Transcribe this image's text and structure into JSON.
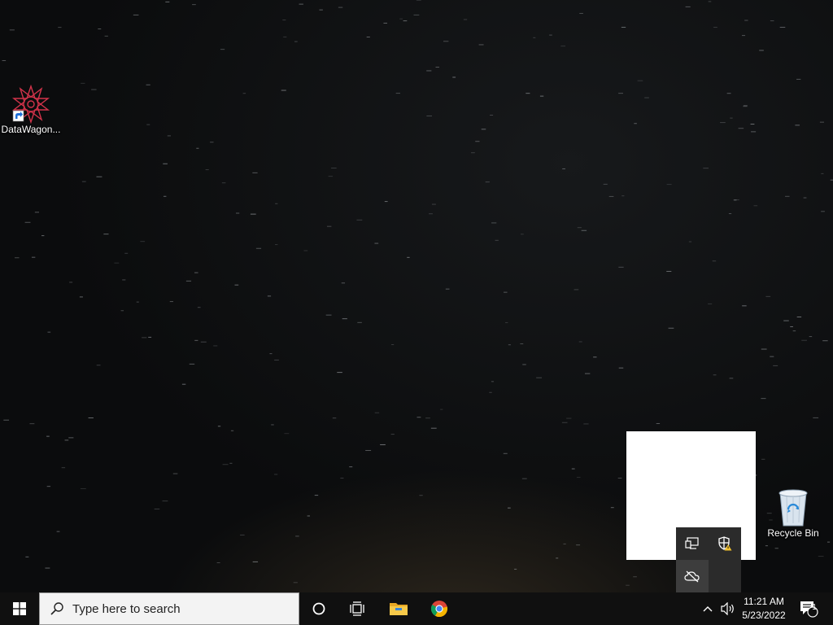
{
  "desktop": {
    "icons": [
      {
        "label": "DataWagon...",
        "icon": "datawagon-app-icon"
      },
      {
        "label": "Recycle Bin",
        "icon": "recycle-bin-icon"
      }
    ]
  },
  "taskbar": {
    "start_icon": "windows-logo-icon",
    "search": {
      "placeholder": "Type here to search",
      "icon": "search-icon"
    },
    "pinned": [
      {
        "name": "cortana",
        "icon": "cortana-icon"
      },
      {
        "name": "task-view",
        "icon": "task-view-icon"
      },
      {
        "name": "file-explorer",
        "icon": "file-explorer-icon"
      },
      {
        "name": "chrome",
        "icon": "chrome-icon"
      }
    ],
    "tray": {
      "chevron_icon": "chevron-up-icon",
      "volume_icon": "volume-icon",
      "time": "11:21 AM",
      "date": "5/23/2022",
      "notifications_count": "1"
    }
  },
  "tray_overflow": {
    "icons": [
      "network-icon",
      "security-warning-icon",
      "cloud-offline-icon"
    ]
  }
}
